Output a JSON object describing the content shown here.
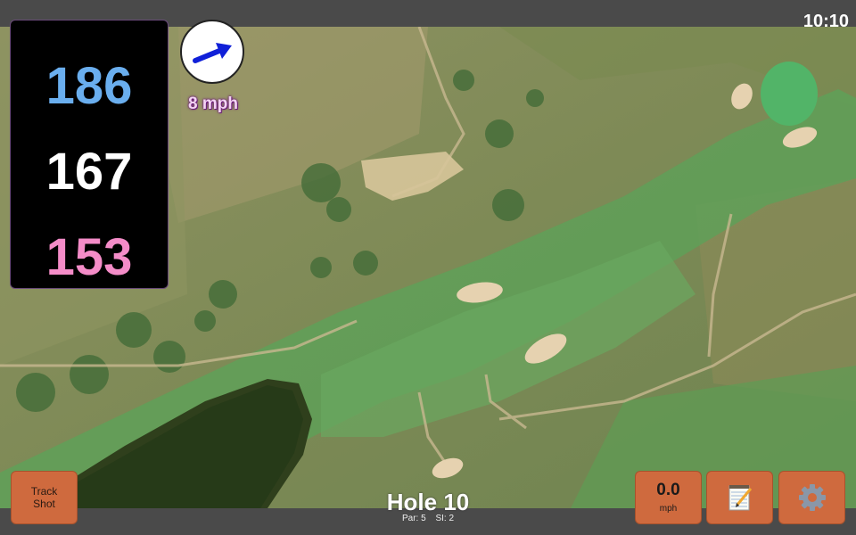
{
  "status": {
    "time": "10:10"
  },
  "yardages": {
    "back": "186",
    "middle": "167",
    "front": "153"
  },
  "wind": {
    "speed_label": "8 mph",
    "direction_icon": "arrow-icon"
  },
  "hole": {
    "title": "Hole 10",
    "par": "Par: 5",
    "si": "SI: 2"
  },
  "buttons": {
    "track_shot": "Track Shot",
    "speed_value": "0.0",
    "speed_unit": "mph",
    "notes_icon": "notepad-icon",
    "settings_icon": "gear-icon"
  },
  "colors": {
    "back_yardage": "#6aaeee",
    "middle_yardage": "#ffffff",
    "front_yardage": "#f48cc8",
    "button": "#cf6a3e",
    "wind_arrow": "#1020d8"
  }
}
